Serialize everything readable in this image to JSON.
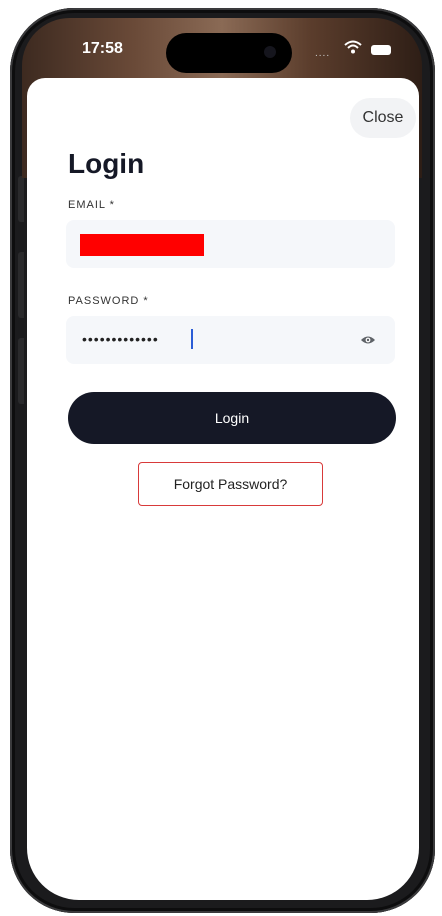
{
  "status_bar": {
    "time": "17:58",
    "signal": "....",
    "wifi_icon": "wifi-icon",
    "battery_icon": "battery-icon"
  },
  "sheet": {
    "close_label": "Close",
    "title": "Login",
    "email": {
      "label": "EMAIL *",
      "value": "",
      "redacted": true,
      "redaction_color": "#ff0000"
    },
    "password": {
      "label": "PASSWORD *",
      "value": "•••••••••••••",
      "toggle_icon": "eye-icon"
    },
    "login_label": "Login",
    "forgot_label": "Forgot Password?"
  },
  "colors": {
    "primary_button": "#151826",
    "field_background": "#f5f7fa",
    "forgot_border": "#d83a3a",
    "caret": "#2b5dd6"
  }
}
